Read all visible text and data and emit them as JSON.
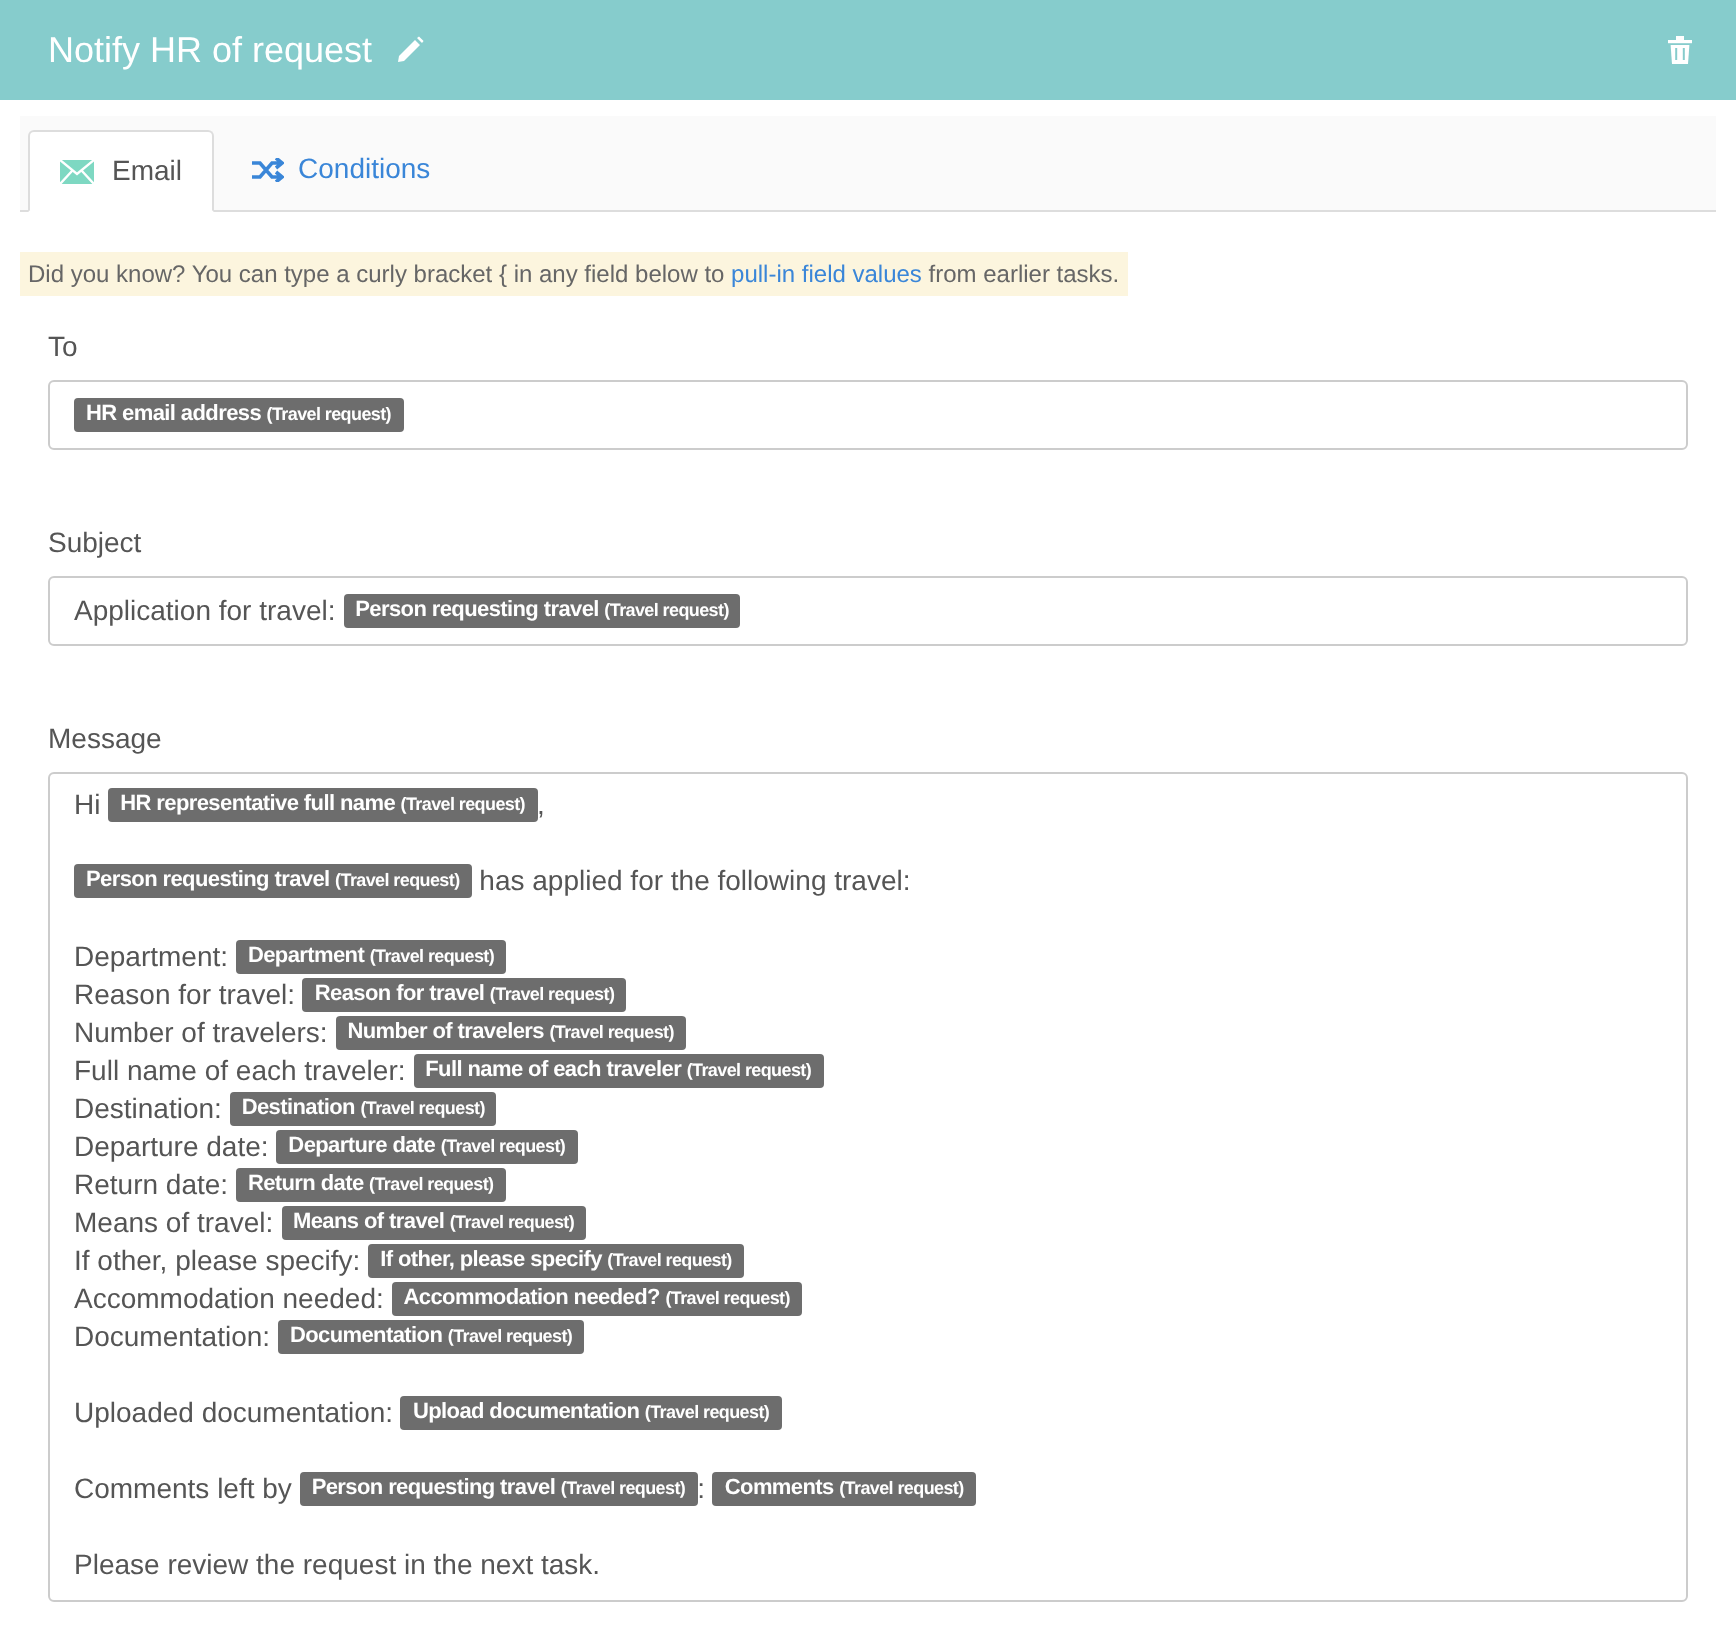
{
  "header": {
    "title": "Notify HR of request"
  },
  "tabs": [
    {
      "label": "Email",
      "selected": true
    },
    {
      "label": "Conditions",
      "selected": false
    }
  ],
  "tip": {
    "before": "Did you know? You can type a curly bracket { in any field below to ",
    "link": "pull-in field values",
    "after": " from earlier tasks."
  },
  "fields": [
    {
      "label": "To",
      "segments": [
        {
          "kind": "token",
          "field": "HR email address",
          "source": "(Travel request)"
        }
      ]
    },
    {
      "label": "Subject",
      "segments": [
        {
          "kind": "text",
          "text": "Application for travel: "
        },
        {
          "kind": "token",
          "field": "Person requesting travel",
          "source": "(Travel request)"
        }
      ]
    }
  ],
  "message": {
    "label": "Message",
    "paragraphs": [
      [
        [
          {
            "kind": "text",
            "text": "Hi "
          },
          {
            "kind": "token",
            "field": "HR representative full name",
            "source": "(Travel request)"
          },
          {
            "kind": "text",
            "text": ","
          }
        ]
      ],
      [
        [
          {
            "kind": "token",
            "field": "Person requesting travel",
            "source": "(Travel request)"
          },
          {
            "kind": "text",
            "text": " has applied for the following travel:"
          }
        ]
      ],
      [
        [
          {
            "kind": "text",
            "text": "Department: "
          },
          {
            "kind": "token",
            "field": "Department",
            "source": "(Travel request)"
          }
        ],
        [
          {
            "kind": "text",
            "text": "Reason for travel: "
          },
          {
            "kind": "token",
            "field": "Reason for travel",
            "source": "(Travel request)"
          }
        ],
        [
          {
            "kind": "text",
            "text": "Number of travelers: "
          },
          {
            "kind": "token",
            "field": "Number of travelers",
            "source": "(Travel request)"
          }
        ],
        [
          {
            "kind": "text",
            "text": "Full name of each traveler: "
          },
          {
            "kind": "token",
            "field": "Full name of each traveler",
            "source": "(Travel request)"
          }
        ],
        [
          {
            "kind": "text",
            "text": "Destination: "
          },
          {
            "kind": "token",
            "field": "Destination",
            "source": "(Travel request)"
          }
        ],
        [
          {
            "kind": "text",
            "text": "Departure date: "
          },
          {
            "kind": "token",
            "field": "Departure date",
            "source": "(Travel request)"
          }
        ],
        [
          {
            "kind": "text",
            "text": "Return date: "
          },
          {
            "kind": "token",
            "field": "Return date",
            "source": "(Travel request)"
          }
        ],
        [
          {
            "kind": "text",
            "text": "Means of travel: "
          },
          {
            "kind": "token",
            "field": "Means of travel",
            "source": "(Travel request)"
          }
        ],
        [
          {
            "kind": "text",
            "text": "If other, please specify: "
          },
          {
            "kind": "token",
            "field": "If other, please specify",
            "source": "(Travel request)"
          }
        ],
        [
          {
            "kind": "text",
            "text": "Accommodation needed: "
          },
          {
            "kind": "token",
            "field": "Accommodation needed?",
            "source": "(Travel request)"
          }
        ],
        [
          {
            "kind": "text",
            "text": "Documentation: "
          },
          {
            "kind": "token",
            "field": "Documentation",
            "source": "(Travel request)"
          }
        ]
      ],
      [
        [
          {
            "kind": "text",
            "text": "Uploaded documentation: "
          },
          {
            "kind": "token",
            "field": "Upload documentation",
            "source": "(Travel request)"
          }
        ]
      ],
      [
        [
          {
            "kind": "text",
            "text": "Comments left by "
          },
          {
            "kind": "token",
            "field": "Person requesting travel",
            "source": "(Travel request)"
          },
          {
            "kind": "text",
            "text": ": "
          },
          {
            "kind": "token",
            "field": "Comments",
            "source": "(Travel request)"
          }
        ]
      ],
      [
        [
          {
            "kind": "text",
            "text": "Please review the request in the next task."
          }
        ]
      ]
    ]
  }
}
